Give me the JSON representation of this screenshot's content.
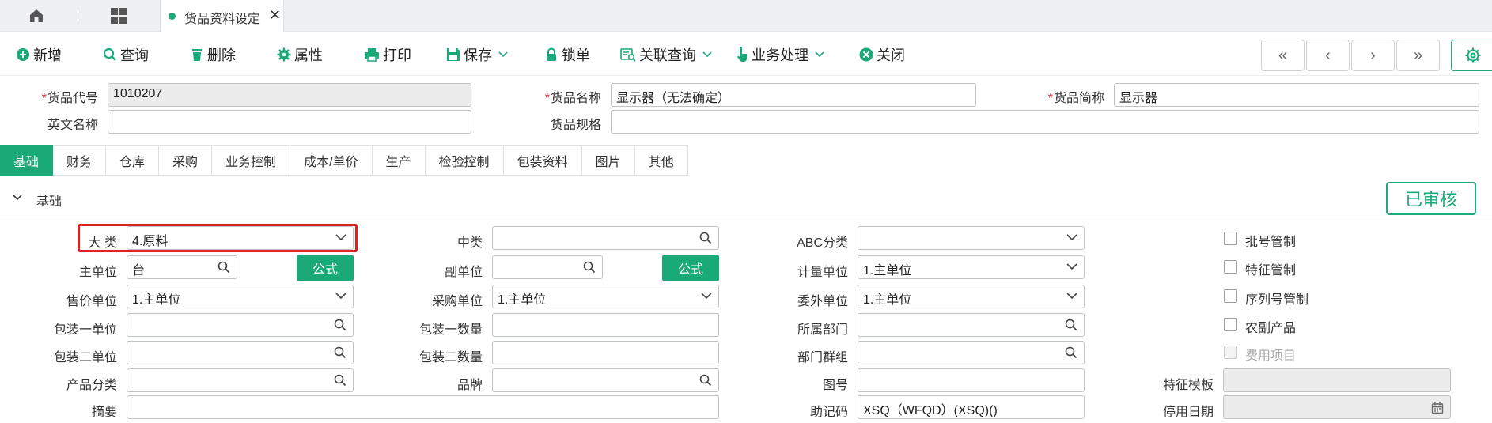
{
  "tabbar": {
    "active_tab": "货品资料设定",
    "close_glyph": "✕"
  },
  "toolbar": {
    "items": [
      "新增",
      "查询",
      "删除",
      "属性",
      "打印",
      "保存",
      "锁单",
      "关联查询",
      "业务处理",
      "关闭"
    ],
    "nav": [
      "«",
      "‹",
      "›",
      "»"
    ]
  },
  "header": {
    "code_label": "货品代号",
    "code_value": "1010207",
    "name_label": "货品名称",
    "name_value": "显示器（无法确定）",
    "short_label": "货品简称",
    "short_value": "显示器",
    "en_label": "英文名称",
    "en_value": "",
    "spec_label": "货品规格",
    "spec_value": ""
  },
  "sections": [
    "基础",
    "财务",
    "仓库",
    "采购",
    "业务控制",
    "成本/单价",
    "生产",
    "检验控制",
    "包装资料",
    "图片",
    "其他"
  ],
  "section_title": "基础",
  "status_stamp": "已审核",
  "form": {
    "col1": {
      "big_class": {
        "label": "大 类",
        "value": "4.原料"
      },
      "main_unit": {
        "label": "主单位",
        "value": "台"
      },
      "formula1": "公式",
      "sale_unit": {
        "label": "售价单位",
        "value": "1.主单位"
      },
      "pack1_unit": {
        "label": "包装一单位",
        "value": ""
      },
      "pack2_unit": {
        "label": "包装二单位",
        "value": ""
      },
      "prod_class": {
        "label": "产品分类",
        "value": ""
      },
      "summary": {
        "label": "摘要",
        "value": ""
      }
    },
    "col2": {
      "mid_class": {
        "label": "中类",
        "value": ""
      },
      "sub_unit": {
        "label": "副单位",
        "value": ""
      },
      "formula2": "公式",
      "purchase_unit": {
        "label": "采购单位",
        "value": "1.主单位"
      },
      "pack1_qty": {
        "label": "包装一数量",
        "value": ""
      },
      "pack2_qty": {
        "label": "包装二数量",
        "value": ""
      },
      "brand": {
        "label": "品牌",
        "value": ""
      }
    },
    "col3": {
      "abc": {
        "label": "ABC分类",
        "value": ""
      },
      "measure_unit": {
        "label": "计量单位",
        "value": "1.主单位"
      },
      "outsource_unit": {
        "label": "委外单位",
        "value": "1.主单位"
      },
      "dept": {
        "label": "所属部门",
        "value": ""
      },
      "dept_group": {
        "label": "部门群组",
        "value": ""
      },
      "drawing_no": {
        "label": "图号",
        "value": ""
      },
      "mnemonic": {
        "label": "助记码",
        "value": "XSQ（WFQD）(XSQ)()"
      }
    },
    "col4": {
      "checks": [
        {
          "label": "批号管制",
          "disabled": false
        },
        {
          "label": "特征管制",
          "disabled": false
        },
        {
          "label": "序列号管制",
          "disabled": false
        },
        {
          "label": "农副产品",
          "disabled": false
        },
        {
          "label": "费用项目",
          "disabled": true
        }
      ],
      "feature_tpl": {
        "label": "特征模板",
        "value": ""
      },
      "stop_date": {
        "label": "停用日期",
        "value": ""
      }
    }
  },
  "colors": {
    "accent": "#1aaa77",
    "highlight": "#e02020",
    "required": "#e03030"
  }
}
